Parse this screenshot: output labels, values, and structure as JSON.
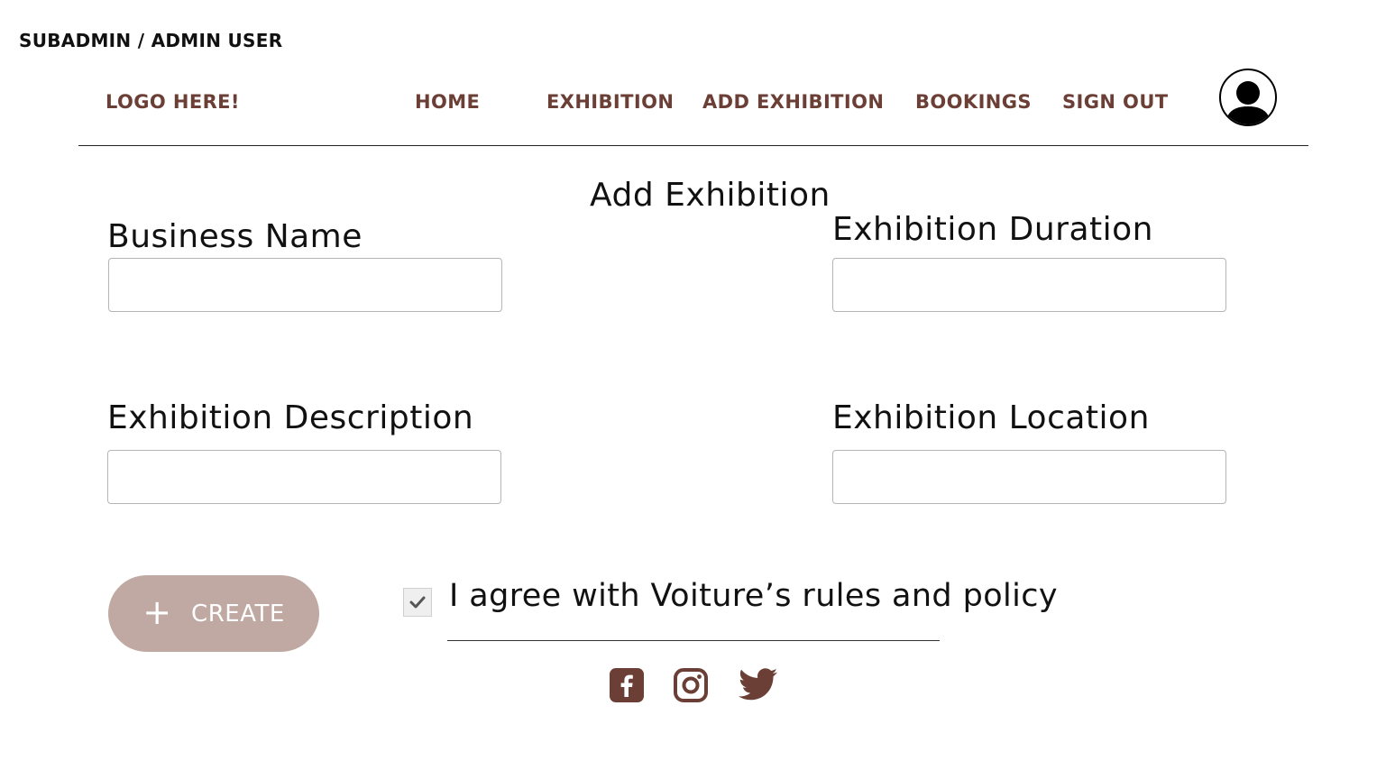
{
  "header": {
    "breadcrumb": "SUBADMIN / ADMIN USER",
    "logo": "LOGO HERE!",
    "nav": {
      "home": "HOME",
      "exhibition": "EXHIBITION",
      "add_exhibition": "ADD EXHIBITION",
      "bookings": "BOOKINGS",
      "sign_out": "SIGN OUT"
    },
    "avatar_icon": "user-avatar-icon"
  },
  "form": {
    "title": "Add Exhibition",
    "business_name": {
      "label": "Business Name",
      "value": "",
      "placeholder": ""
    },
    "exhibition_duration": {
      "label": "Exhibition Duration",
      "value": "",
      "placeholder": ""
    },
    "exhibition_description": {
      "label": "Exhibition Description",
      "value": "",
      "placeholder": ""
    },
    "exhibition_location": {
      "label": "Exhibition Location",
      "value": "",
      "placeholder": ""
    },
    "create_button": {
      "icon": "plus-icon",
      "label": "CREATE"
    },
    "agreement": {
      "checked": true,
      "label": "I agree with Voiture’s rules and policy"
    }
  },
  "footer": {
    "social_icons": [
      "facebook-icon",
      "instagram-icon",
      "twitter-icon"
    ]
  },
  "colors": {
    "nav_text": "#6b3f35",
    "create_button_bg": "#bfa9a2",
    "social_icon": "#6b3f35"
  }
}
